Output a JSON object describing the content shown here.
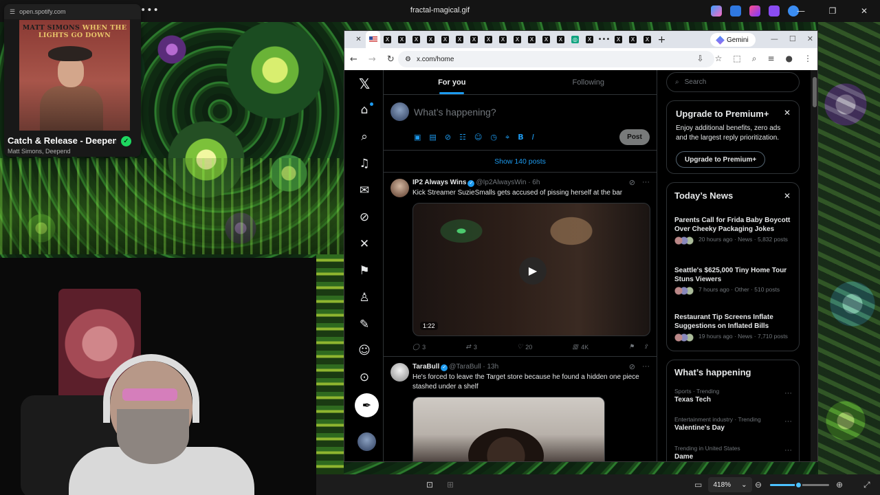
{
  "viewer": {
    "title": "fractal-magical.gif",
    "zoom": "418%",
    "zoom_fraction": 0.48
  },
  "spotify": {
    "url": "open.spotify.com",
    "album_text_a": "MATT SIMONS",
    "album_text_b": "WHEN THE LIGHTS GO DOWN",
    "song": "Catch & Release - Deepen",
    "artist": "Matt Simons, Deepend",
    "accent": "#1ed760"
  },
  "browser": {
    "gemini_label": "Gemini",
    "url": "x.com/home",
    "tab_icons": [
      "x-logo",
      "x-logo",
      "x-logo",
      "x-logo",
      "x-logo",
      "x-logo",
      "x-logo",
      "x-logo",
      "x-logo",
      "x-logo",
      "x-logo",
      "x-logo",
      "x-logo",
      "chatgpt",
      "x-logo",
      "more",
      "x-logo",
      "x-logo",
      "x-logo"
    ]
  },
  "x": {
    "tabs": [
      "For you",
      "Following"
    ],
    "composer_placeholder": "What’s happening?",
    "post_button": "Post",
    "show_posts": "Show 140 posts",
    "accent": "#1d9bf0",
    "tweets": [
      {
        "name": "IP2 Always Wins",
        "handle_time": "@Ip2AlwaysWin · 6h",
        "text": "Kick Streamer SuzieSmalls gets accused of pissing herself at the bar",
        "duration": "1:22",
        "replies": "3",
        "reposts": "3",
        "likes": "20",
        "views": "4K"
      },
      {
        "name": "TaraBull",
        "handle_time": "@TaraBull · 13h",
        "text": "He's forced to leave the Target store because he found a hidden one piece stashed under a shelf"
      }
    ],
    "search_placeholder": "Search",
    "premium": {
      "title": "Upgrade to Premium+",
      "body": "Enjoy additional benefits, zero ads and the largest reply prioritization.",
      "button": "Upgrade to Premium+"
    },
    "news": {
      "title": "Today’s News",
      "items": [
        {
          "title": "Parents Call for Frida Baby Boycott Over Cheeky Packaging Jokes",
          "meta": "20 hours ago · News · 5,832 posts"
        },
        {
          "title": "Seattle's $625,000 Tiny Home Tour Stuns Viewers",
          "meta": "7 hours ago · Other · 510 posts"
        },
        {
          "title": "Restaurant Tip Screens Inflate Suggestions on Inflated Bills",
          "meta": "19 hours ago · News · 7,710 posts"
        }
      ]
    },
    "happening": {
      "title": "What’s happening",
      "items": [
        {
          "context": "Sports · Trending",
          "topic": "Texas Tech"
        },
        {
          "context": "Entertainment industry · Trending",
          "topic": "Valentine's Day"
        },
        {
          "context": "Trending in United States",
          "topic": "Dame"
        }
      ]
    }
  }
}
